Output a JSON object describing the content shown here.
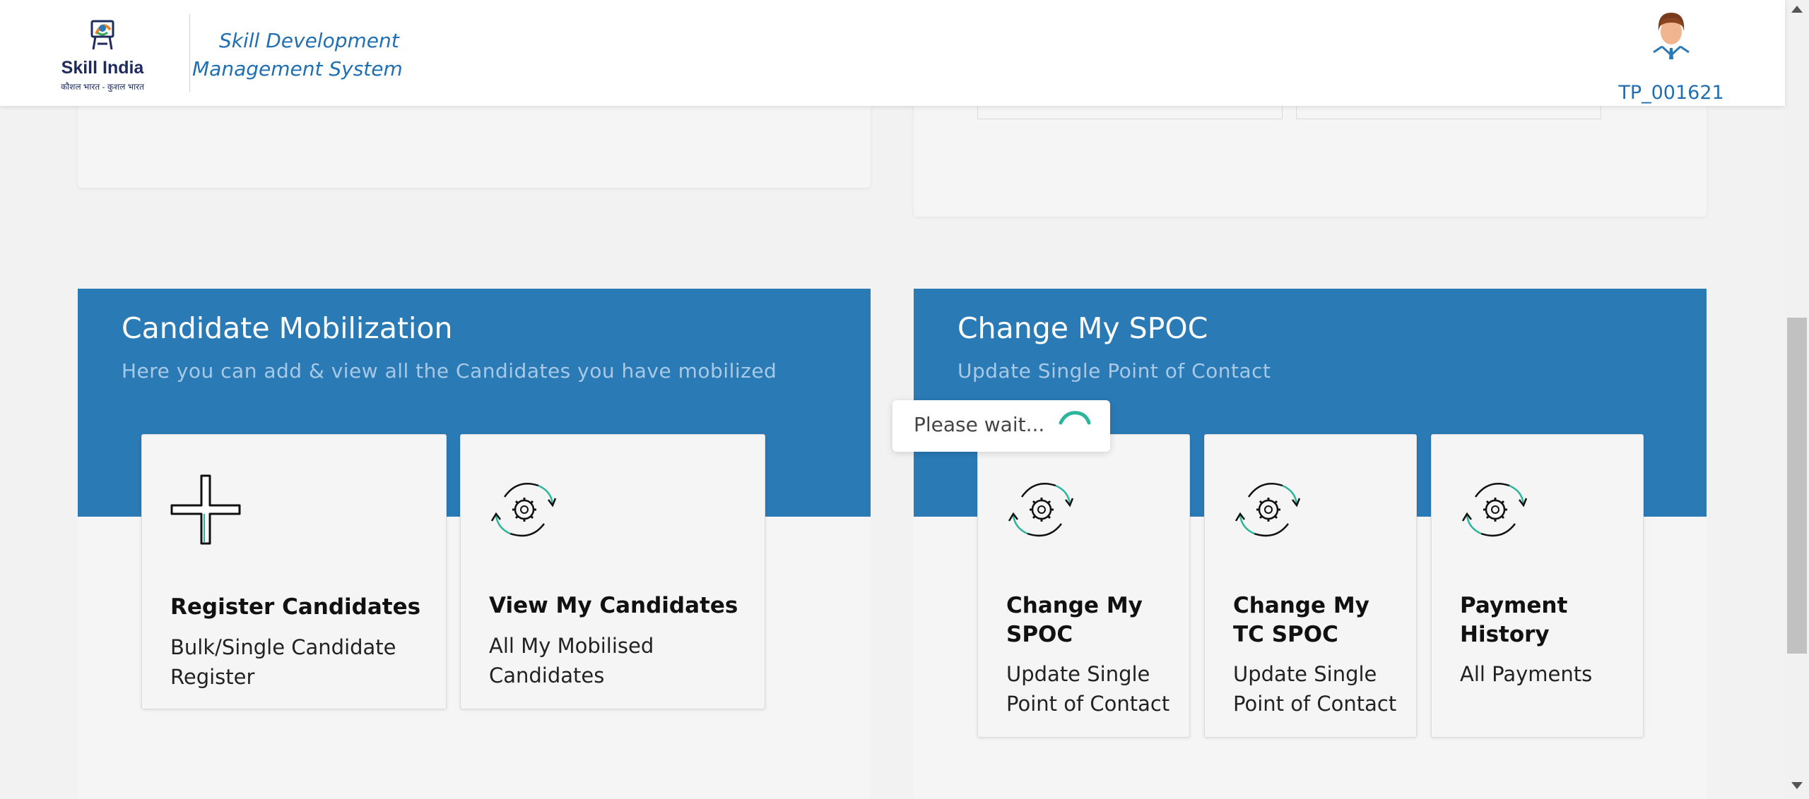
{
  "header": {
    "logo_title": "Skill India",
    "logo_subtitle": "कौशल भारत - कुशल भारत",
    "system_title": "Skill Development Management System",
    "user_id": "TP_001621"
  },
  "candidate_mobilization": {
    "title": "Candidate Mobilization",
    "subtitle": "Here you can add & view all the Candidates you have mobilized",
    "cards": [
      {
        "title": "Register Candidates",
        "desc": "Bulk/Single Candidate Register",
        "icon": "plus-icon"
      },
      {
        "title": "View My Candidates",
        "desc": "All My Mobilised Candidates",
        "icon": "gear-refresh-icon"
      }
    ]
  },
  "change_spoc": {
    "title": "Change My SPOC",
    "subtitle": "Update Single Point of Contact",
    "cards": [
      {
        "title": "Change My SPOC",
        "desc": "Update Single Point of Contact",
        "icon": "gear-refresh-icon"
      },
      {
        "title": "Change My TC SPOC",
        "desc": "Update Single Point of Contact",
        "icon": "gear-refresh-icon"
      },
      {
        "title": "Payment History",
        "desc": "All Payments",
        "icon": "gear-refresh-icon"
      }
    ]
  },
  "loading": {
    "text": "Please wait..."
  },
  "colors": {
    "primary_blue": "#2a7ab6",
    "link_blue": "#1f6fb2",
    "spinner_teal": "#2bb59a"
  }
}
